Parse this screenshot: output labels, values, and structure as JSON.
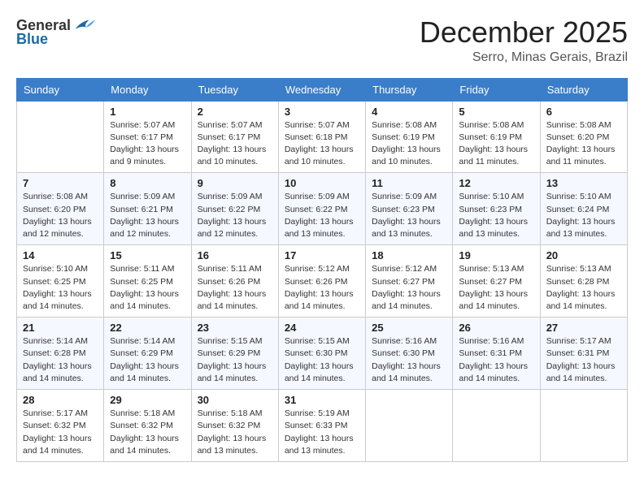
{
  "header": {
    "logo": {
      "text_general": "General",
      "text_blue": "Blue"
    },
    "title": "December 2025",
    "location": "Serro, Minas Gerais, Brazil"
  },
  "calendar": {
    "days_of_week": [
      "Sunday",
      "Monday",
      "Tuesday",
      "Wednesday",
      "Thursday",
      "Friday",
      "Saturday"
    ],
    "weeks": [
      [
        {
          "day": "",
          "info": ""
        },
        {
          "day": "1",
          "info": "Sunrise: 5:07 AM\nSunset: 6:17 PM\nDaylight: 13 hours\nand 9 minutes."
        },
        {
          "day": "2",
          "info": "Sunrise: 5:07 AM\nSunset: 6:17 PM\nDaylight: 13 hours\nand 10 minutes."
        },
        {
          "day": "3",
          "info": "Sunrise: 5:07 AM\nSunset: 6:18 PM\nDaylight: 13 hours\nand 10 minutes."
        },
        {
          "day": "4",
          "info": "Sunrise: 5:08 AM\nSunset: 6:19 PM\nDaylight: 13 hours\nand 10 minutes."
        },
        {
          "day": "5",
          "info": "Sunrise: 5:08 AM\nSunset: 6:19 PM\nDaylight: 13 hours\nand 11 minutes."
        },
        {
          "day": "6",
          "info": "Sunrise: 5:08 AM\nSunset: 6:20 PM\nDaylight: 13 hours\nand 11 minutes."
        }
      ],
      [
        {
          "day": "7",
          "info": "Sunrise: 5:08 AM\nSunset: 6:20 PM\nDaylight: 13 hours\nand 12 minutes."
        },
        {
          "day": "8",
          "info": "Sunrise: 5:09 AM\nSunset: 6:21 PM\nDaylight: 13 hours\nand 12 minutes."
        },
        {
          "day": "9",
          "info": "Sunrise: 5:09 AM\nSunset: 6:22 PM\nDaylight: 13 hours\nand 12 minutes."
        },
        {
          "day": "10",
          "info": "Sunrise: 5:09 AM\nSunset: 6:22 PM\nDaylight: 13 hours\nand 13 minutes."
        },
        {
          "day": "11",
          "info": "Sunrise: 5:09 AM\nSunset: 6:23 PM\nDaylight: 13 hours\nand 13 minutes."
        },
        {
          "day": "12",
          "info": "Sunrise: 5:10 AM\nSunset: 6:23 PM\nDaylight: 13 hours\nand 13 minutes."
        },
        {
          "day": "13",
          "info": "Sunrise: 5:10 AM\nSunset: 6:24 PM\nDaylight: 13 hours\nand 13 minutes."
        }
      ],
      [
        {
          "day": "14",
          "info": "Sunrise: 5:10 AM\nSunset: 6:25 PM\nDaylight: 13 hours\nand 14 minutes."
        },
        {
          "day": "15",
          "info": "Sunrise: 5:11 AM\nSunset: 6:25 PM\nDaylight: 13 hours\nand 14 minutes."
        },
        {
          "day": "16",
          "info": "Sunrise: 5:11 AM\nSunset: 6:26 PM\nDaylight: 13 hours\nand 14 minutes."
        },
        {
          "day": "17",
          "info": "Sunrise: 5:12 AM\nSunset: 6:26 PM\nDaylight: 13 hours\nand 14 minutes."
        },
        {
          "day": "18",
          "info": "Sunrise: 5:12 AM\nSunset: 6:27 PM\nDaylight: 13 hours\nand 14 minutes."
        },
        {
          "day": "19",
          "info": "Sunrise: 5:13 AM\nSunset: 6:27 PM\nDaylight: 13 hours\nand 14 minutes."
        },
        {
          "day": "20",
          "info": "Sunrise: 5:13 AM\nSunset: 6:28 PM\nDaylight: 13 hours\nand 14 minutes."
        }
      ],
      [
        {
          "day": "21",
          "info": "Sunrise: 5:14 AM\nSunset: 6:28 PM\nDaylight: 13 hours\nand 14 minutes."
        },
        {
          "day": "22",
          "info": "Sunrise: 5:14 AM\nSunset: 6:29 PM\nDaylight: 13 hours\nand 14 minutes."
        },
        {
          "day": "23",
          "info": "Sunrise: 5:15 AM\nSunset: 6:29 PM\nDaylight: 13 hours\nand 14 minutes."
        },
        {
          "day": "24",
          "info": "Sunrise: 5:15 AM\nSunset: 6:30 PM\nDaylight: 13 hours\nand 14 minutes."
        },
        {
          "day": "25",
          "info": "Sunrise: 5:16 AM\nSunset: 6:30 PM\nDaylight: 13 hours\nand 14 minutes."
        },
        {
          "day": "26",
          "info": "Sunrise: 5:16 AM\nSunset: 6:31 PM\nDaylight: 13 hours\nand 14 minutes."
        },
        {
          "day": "27",
          "info": "Sunrise: 5:17 AM\nSunset: 6:31 PM\nDaylight: 13 hours\nand 14 minutes."
        }
      ],
      [
        {
          "day": "28",
          "info": "Sunrise: 5:17 AM\nSunset: 6:32 PM\nDaylight: 13 hours\nand 14 minutes."
        },
        {
          "day": "29",
          "info": "Sunrise: 5:18 AM\nSunset: 6:32 PM\nDaylight: 13 hours\nand 14 minutes."
        },
        {
          "day": "30",
          "info": "Sunrise: 5:18 AM\nSunset: 6:32 PM\nDaylight: 13 hours\nand 13 minutes."
        },
        {
          "day": "31",
          "info": "Sunrise: 5:19 AM\nSunset: 6:33 PM\nDaylight: 13 hours\nand 13 minutes."
        },
        {
          "day": "",
          "info": ""
        },
        {
          "day": "",
          "info": ""
        },
        {
          "day": "",
          "info": ""
        }
      ]
    ]
  }
}
